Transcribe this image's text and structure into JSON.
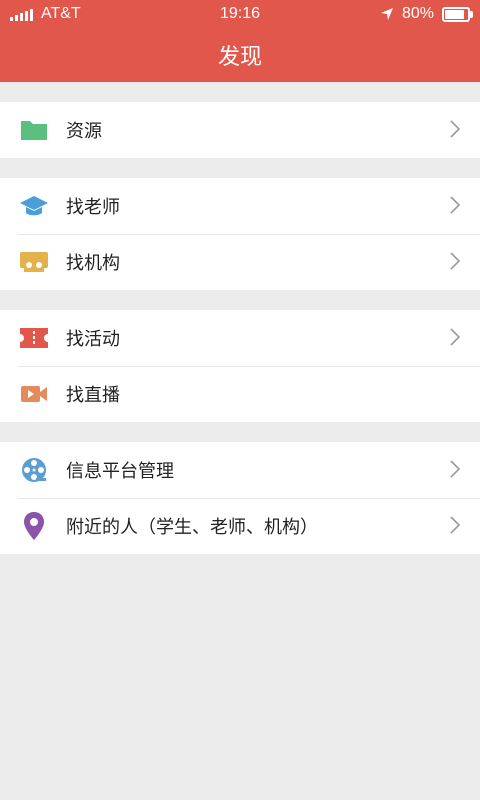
{
  "status": {
    "carrier": "AT&T",
    "time": "19:16",
    "battery": "80%",
    "battery_level": 0.8
  },
  "header": {
    "title": "发现"
  },
  "groups": [
    {
      "items": [
        {
          "label": "资源",
          "icon": "folder-icon",
          "color": "#5bbf7f",
          "chevron": true
        }
      ]
    },
    {
      "items": [
        {
          "label": "找老师",
          "icon": "graduation-cap-icon",
          "color": "#4a9fd8",
          "chevron": true
        },
        {
          "label": "找机构",
          "icon": "institution-icon",
          "color": "#e3b24a",
          "chevron": true
        }
      ]
    },
    {
      "items": [
        {
          "label": "找活动",
          "icon": "ticket-icon",
          "color": "#e2574c",
          "chevron": true
        },
        {
          "label": "找直播",
          "icon": "video-camera-icon",
          "color": "#e58a5a",
          "chevron": false
        }
      ]
    },
    {
      "items": [
        {
          "label": "信息平台管理",
          "icon": "film-reel-icon",
          "color": "#5a9fd0",
          "chevron": true
        },
        {
          "label": "附近的人（学生、老师、机构）",
          "icon": "location-pin-icon",
          "color": "#8a55a8",
          "chevron": true
        }
      ]
    }
  ]
}
